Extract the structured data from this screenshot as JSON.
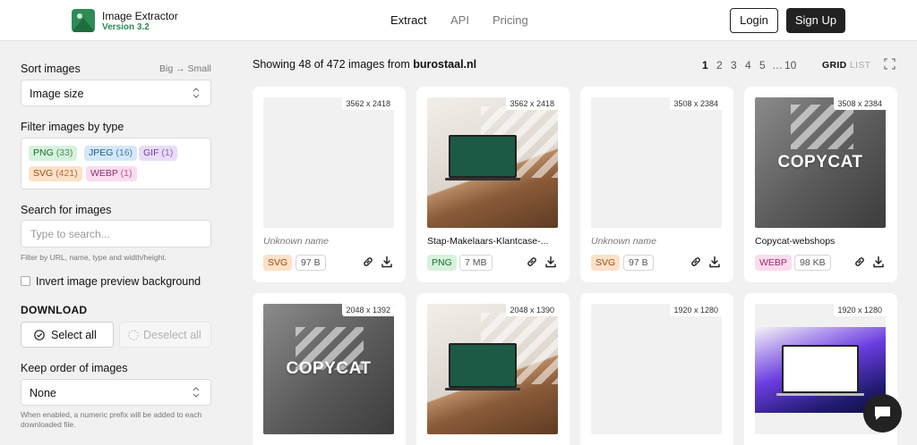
{
  "header": {
    "app_title": "Image Extractor",
    "version": "Version 3.2",
    "nav": [
      "Extract",
      "API",
      "Pricing"
    ],
    "login": "Login",
    "signup": "Sign Up"
  },
  "sidebar": {
    "sort_label": "Sort images",
    "sort_hint": "Big",
    "sort_hint_arrow": "→",
    "sort_hint_to": "Small",
    "sort_value": "Image size",
    "filter_label": "Filter images by type",
    "filters": [
      {
        "type": "PNG",
        "count": "(33)"
      },
      {
        "type": "JPEG",
        "count": "(16)"
      },
      {
        "type": "GIF",
        "count": "(1)"
      },
      {
        "type": "SVG",
        "count": "(421)"
      },
      {
        "type": "WEBP",
        "count": "(1)"
      }
    ],
    "search_label": "Search for images",
    "search_placeholder": "Type to search...",
    "search_hint": "Filter by URL, name, type and width/height.",
    "invert_label": "Invert image preview background",
    "download_title": "DOWNLOAD",
    "select_all": "Select all",
    "deselect_all": "Deselect all",
    "order_label": "Keep order of images",
    "order_value": "None",
    "order_note": "When enabled, a numeric prefix will be added to each downloaded file."
  },
  "main": {
    "showing_prefix": "Showing 48 of 472 images from",
    "domain": "burostaal.nl",
    "pages": [
      "1",
      "2",
      "3",
      "4",
      "5",
      "…",
      "10"
    ],
    "view_grid": "GRID",
    "view_list": "LIST",
    "cards": [
      {
        "dims": "3562 x 2418",
        "name": "Unknown name",
        "type": "SVG",
        "size": "97 B"
      },
      {
        "dims": "3562 x 2418",
        "name": "Stap-Makelaars-Klantcase-...",
        "type": "PNG",
        "size": "7 MB"
      },
      {
        "dims": "3508 x 2384",
        "name": "Unknown name",
        "type": "SVG",
        "size": "97 B"
      },
      {
        "dims": "3508 x 2384",
        "name": "Copycat-webshops",
        "type": "WEBP",
        "size": "98 KB",
        "overlay": "COPYCAT"
      },
      {
        "dims": "2048 x 1392",
        "overlay": "COPYCAT"
      },
      {
        "dims": "2048 x 1390"
      },
      {
        "dims": "1920 x 1280"
      },
      {
        "dims": "1920 x 1280"
      }
    ]
  },
  "colors": {
    "brand": "#2e8b57",
    "dark": "#222222"
  }
}
